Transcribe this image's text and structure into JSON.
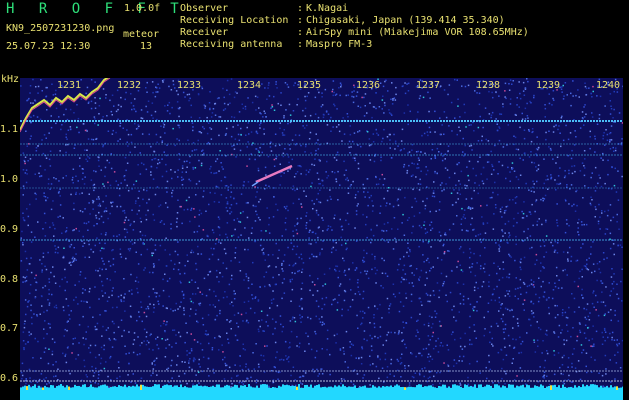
{
  "header": {
    "title": "H R O F F T",
    "version": "1.0.0f",
    "filename": "KN9_2507231230.png",
    "kind": "meteor",
    "datetime": "25.07.23 12:30",
    "count": "13",
    "info": [
      {
        "label": "Observer",
        "value": "K.Nagai"
      },
      {
        "label": "Receiving Location",
        "value": "Chigasaki, Japan (139.414 35.340)"
      },
      {
        "label": "Receiver",
        "value": "AirSpy mini (Miakejima VOR 108.65MHz)"
      },
      {
        "label": "Receiving antenna",
        "value": "Maspro FM-3"
      }
    ]
  },
  "axis": {
    "y_unit": "kHz",
    "y_labels": [
      "1.1",
      "1.0",
      "0.9",
      "0.8",
      "0.7",
      "0.6"
    ],
    "x_labels": [
      "1231",
      "1232",
      "1233",
      "1234",
      "1235",
      "1236",
      "1237",
      "1238",
      "1239",
      "1240"
    ]
  },
  "colors": {
    "background": "#000000",
    "plot": "#0d0e5a",
    "text": "#e8e070",
    "title": "#2ee07a",
    "carrier": "#4fc8ff",
    "baseline": "#22d8ff"
  }
}
